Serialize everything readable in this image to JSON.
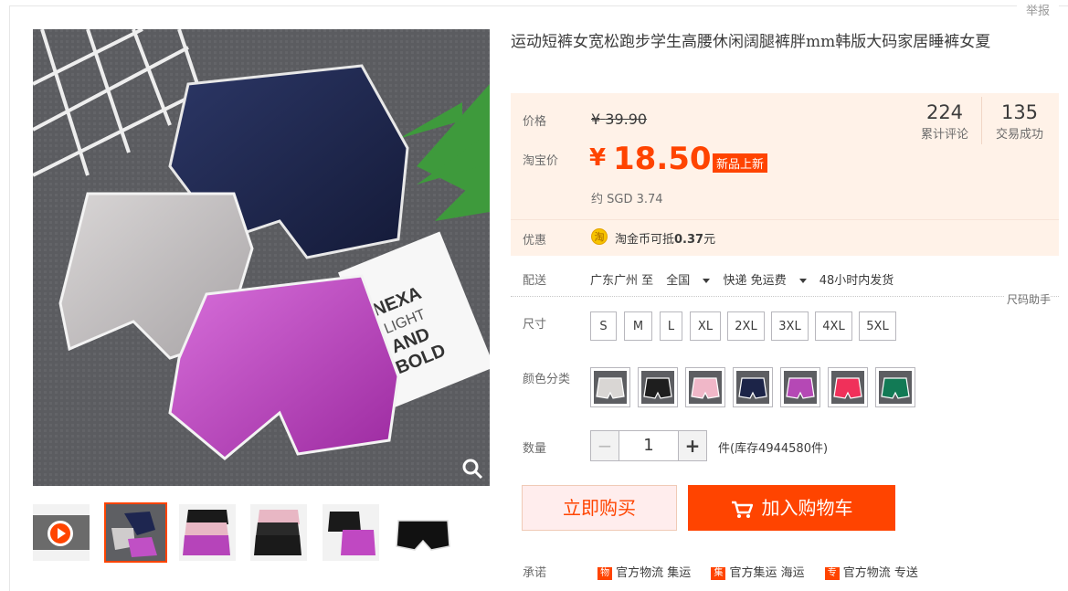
{
  "report_label": "举报",
  "product": {
    "title": "运动短裤女宽松跑步学生高腰休闲阔腿裤胖mm韩版大码家居睡裤女夏",
    "image_text": [
      "NEXA",
      "LIGHT",
      "AND",
      "BOLD"
    ]
  },
  "price": {
    "label": "价格",
    "old_currency": "¥",
    "old_value": "39.90",
    "taobao_label": "淘宝价",
    "currency": "¥",
    "value": "18.50",
    "badge": "新品上新",
    "approx": "约 SGD 3.74"
  },
  "stats": {
    "reviews_count": "224",
    "reviews_label": "累计评论",
    "sales_count": "135",
    "sales_label": "交易成功"
  },
  "promo": {
    "label": "优惠",
    "coin_symbol": "淘",
    "text_prefix": "淘金币可抵",
    "amount": "0.37",
    "text_suffix": "元"
  },
  "shipping": {
    "label": "配送",
    "from": "广东广州 至",
    "to": "全国",
    "method": "快递 免运费",
    "time": "48小时内发货"
  },
  "size": {
    "label": "尺寸",
    "helper": "尺码助手",
    "options": [
      "S",
      "M",
      "L",
      "XL",
      "2XL",
      "3XL",
      "4XL",
      "5XL"
    ]
  },
  "color": {
    "label": "颜色分类",
    "swatches": [
      "#d9d6d4",
      "#1e1e1e",
      "#f0b7c8",
      "#1c2448",
      "#b548b5",
      "#f0305a",
      "#127a55"
    ]
  },
  "quantity": {
    "label": "数量",
    "minus": "−",
    "value": "1",
    "plus": "+",
    "stock": "件(库存4944580件)"
  },
  "actions": {
    "buy_now": "立即购买",
    "add_to_cart": "加入购物车"
  },
  "promise": {
    "label": "承诺",
    "items": [
      "官方物流 集运",
      "官方集运 海运",
      "官方物流 专送"
    ]
  },
  "thumbnails": [
    "video",
    "photo",
    "photo",
    "photo",
    "photo",
    "photo"
  ],
  "colors": {
    "accent": "#ff4400",
    "price_bg": "#fff2e8"
  }
}
